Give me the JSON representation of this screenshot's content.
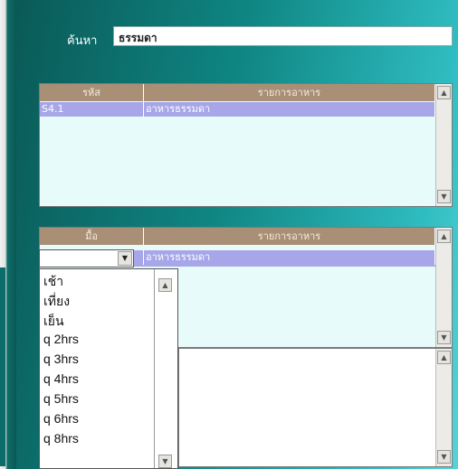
{
  "search": {
    "label": "ค้นหา",
    "value": "ธรรมดา"
  },
  "top_grid": {
    "columns": [
      "รหัส",
      "รายการอาหาร"
    ],
    "rows": [
      {
        "code": "S4.1",
        "name": "อาหารธรรมดา"
      }
    ]
  },
  "bottom_grid": {
    "columns": [
      "มื้อ",
      "รายการอาหาร"
    ],
    "rows": [
      {
        "meal": "",
        "name": "อาหารธรรมดา"
      }
    ]
  },
  "meal_dropdown": {
    "value": "",
    "options": [
      "เช้า",
      "เที่ยง",
      "เย็น",
      "q 2hrs",
      "q 3hrs",
      "q 4hrs",
      "q 5hrs",
      "q 6hrs",
      "q 8hrs"
    ]
  },
  "colors": {
    "header": "#a88f76",
    "selected_row": "#a6a6e8",
    "grid_bg": "#e8fbfb"
  },
  "icons": {
    "scroll_up": "▲",
    "scroll_down": "▼",
    "dropdown": "▼"
  }
}
